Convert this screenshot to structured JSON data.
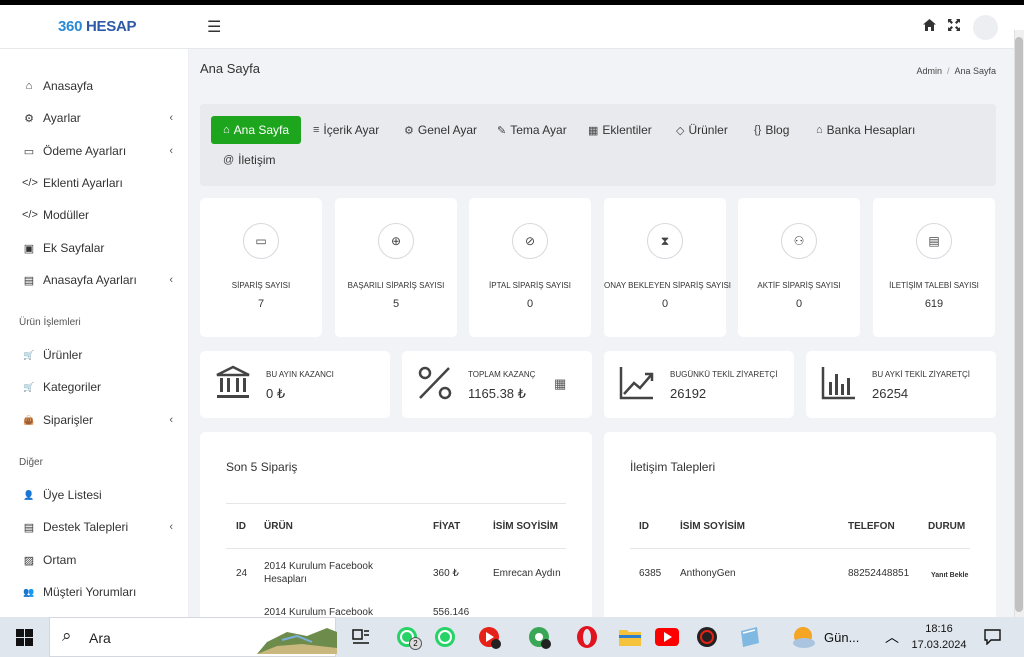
{
  "logo": {
    "num": "360",
    "text": "HESAP"
  },
  "topbar": {
    "home_icon": "home-icon",
    "expand_icon": "expand-icon"
  },
  "sidebar": {
    "items": [
      {
        "label": "Anasayfa",
        "icon": "⌂",
        "chev": false
      },
      {
        "label": "Ayarlar",
        "icon": "⚙",
        "chev": true
      },
      {
        "label": "Ödeme Ayarları",
        "icon": "▭",
        "chev": true
      },
      {
        "label": "Eklenti Ayarları",
        "icon": "</>",
        "chev": false
      },
      {
        "label": "Modüller",
        "icon": "</>",
        "chev": false
      },
      {
        "label": "Ek Sayfalar",
        "icon": "▣",
        "chev": false
      },
      {
        "label": "Anasayfa Ayarları",
        "icon": "▤",
        "chev": true
      }
    ],
    "section_products": "Ürün İşlemleri",
    "product_items": [
      {
        "label": "Ürünler",
        "icon": "🛒",
        "chev": false
      },
      {
        "label": "Kategoriler",
        "icon": "🛒",
        "chev": false
      },
      {
        "label": "Siparişler",
        "icon": "👜",
        "chev": true
      }
    ],
    "section_other": "Diğer",
    "other_items": [
      {
        "label": "Üye Listesi",
        "icon": "👤",
        "chev": false
      },
      {
        "label": "Destek Talepleri",
        "icon": "▤",
        "chev": true
      },
      {
        "label": "Ortam",
        "icon": "▨",
        "chev": false
      },
      {
        "label": "Müşteri Yorumları",
        "icon": "👥",
        "chev": false
      }
    ],
    "chevron": "‹"
  },
  "page": {
    "title": "Ana Sayfa",
    "breadcrumb": [
      "Admin",
      "Ana Sayfa"
    ],
    "breadcrumb_sep": "/"
  },
  "tabs": [
    {
      "label": "Ana Sayfa",
      "icon": "⌂",
      "active": true
    },
    {
      "label": "İçerik Ayar",
      "icon": "≡",
      "active": false
    },
    {
      "label": "Genel Ayar",
      "icon": "⚙",
      "active": false
    },
    {
      "label": "Tema Ayar",
      "icon": "✎",
      "active": false
    },
    {
      "label": "Eklentiler",
      "icon": "▦",
      "active": false
    },
    {
      "label": "Ürünler",
      "icon": "◇",
      "active": false
    },
    {
      "label": "Blog",
      "icon": "{}",
      "active": false
    },
    {
      "label": "Banka Hesapları",
      "icon": "⌂",
      "active": false
    },
    {
      "label": "İletişim",
      "icon": "@",
      "active": false
    }
  ],
  "stats": [
    {
      "label": "SİPARİŞ SAYISI",
      "value": "7",
      "icon": "▭"
    },
    {
      "label": "BAŞARILI SİPARİŞ SAYISI",
      "value": "5",
      "icon": "⊕"
    },
    {
      "label": "İPTAL SİPARİŞ SAYISI",
      "value": "0",
      "icon": "⊘"
    },
    {
      "label": "ONAY BEKLEYEN SİPARİŞ SAYISI",
      "value": "0",
      "icon": "⧗"
    },
    {
      "label": "AKTİF SİPARİŞ SAYISI",
      "value": "0",
      "icon": "⚇"
    },
    {
      "label": "İLETİŞİM TALEBİ SAYISI",
      "value": "619",
      "icon": "▤"
    }
  ],
  "kpis": [
    {
      "label": "BU AYIN KAZANCI",
      "value": "0 ₺",
      "icon": "bank-icon"
    },
    {
      "label": "TOPLAM KAZANÇ",
      "value": "1165.38 ₺",
      "icon": "percent-icon"
    },
    {
      "label": "BUGÜNKÜ TEKİL ZİYARETÇİ",
      "value": "26192",
      "icon": "trend-icon"
    },
    {
      "label": "BU AYKİ TEKİL ZİYARETÇİ",
      "value": "26254",
      "icon": "bars-icon"
    }
  ],
  "orders": {
    "title": "Son 5 Sipariş",
    "headers": [
      "ID",
      "ÜRÜN",
      "FİYAT",
      "İSİM SOYİSİM"
    ],
    "rows": [
      {
        "id": "24",
        "product": "2014 Kurulum Facebook Hesapları",
        "price": "360 ₺",
        "name": "Emrecan Aydın"
      },
      {
        "id": "",
        "product": "2014 Kurulum Facebook",
        "price": "556.146",
        "name": ""
      }
    ]
  },
  "contacts": {
    "title": "İletişim Talepleri",
    "headers": [
      "ID",
      "İSİM SOYİSİM",
      "TELEFON",
      "DURUM"
    ],
    "rows": [
      {
        "id": "6385",
        "name": "AnthonyGen",
        "phone": "88252448851",
        "status": "Yanıt Bekle"
      }
    ]
  },
  "taskbar": {
    "search_text": "Ara",
    "weather": "Gün...",
    "time": "18:16",
    "date": "17.03.2024",
    "badge": "2"
  }
}
